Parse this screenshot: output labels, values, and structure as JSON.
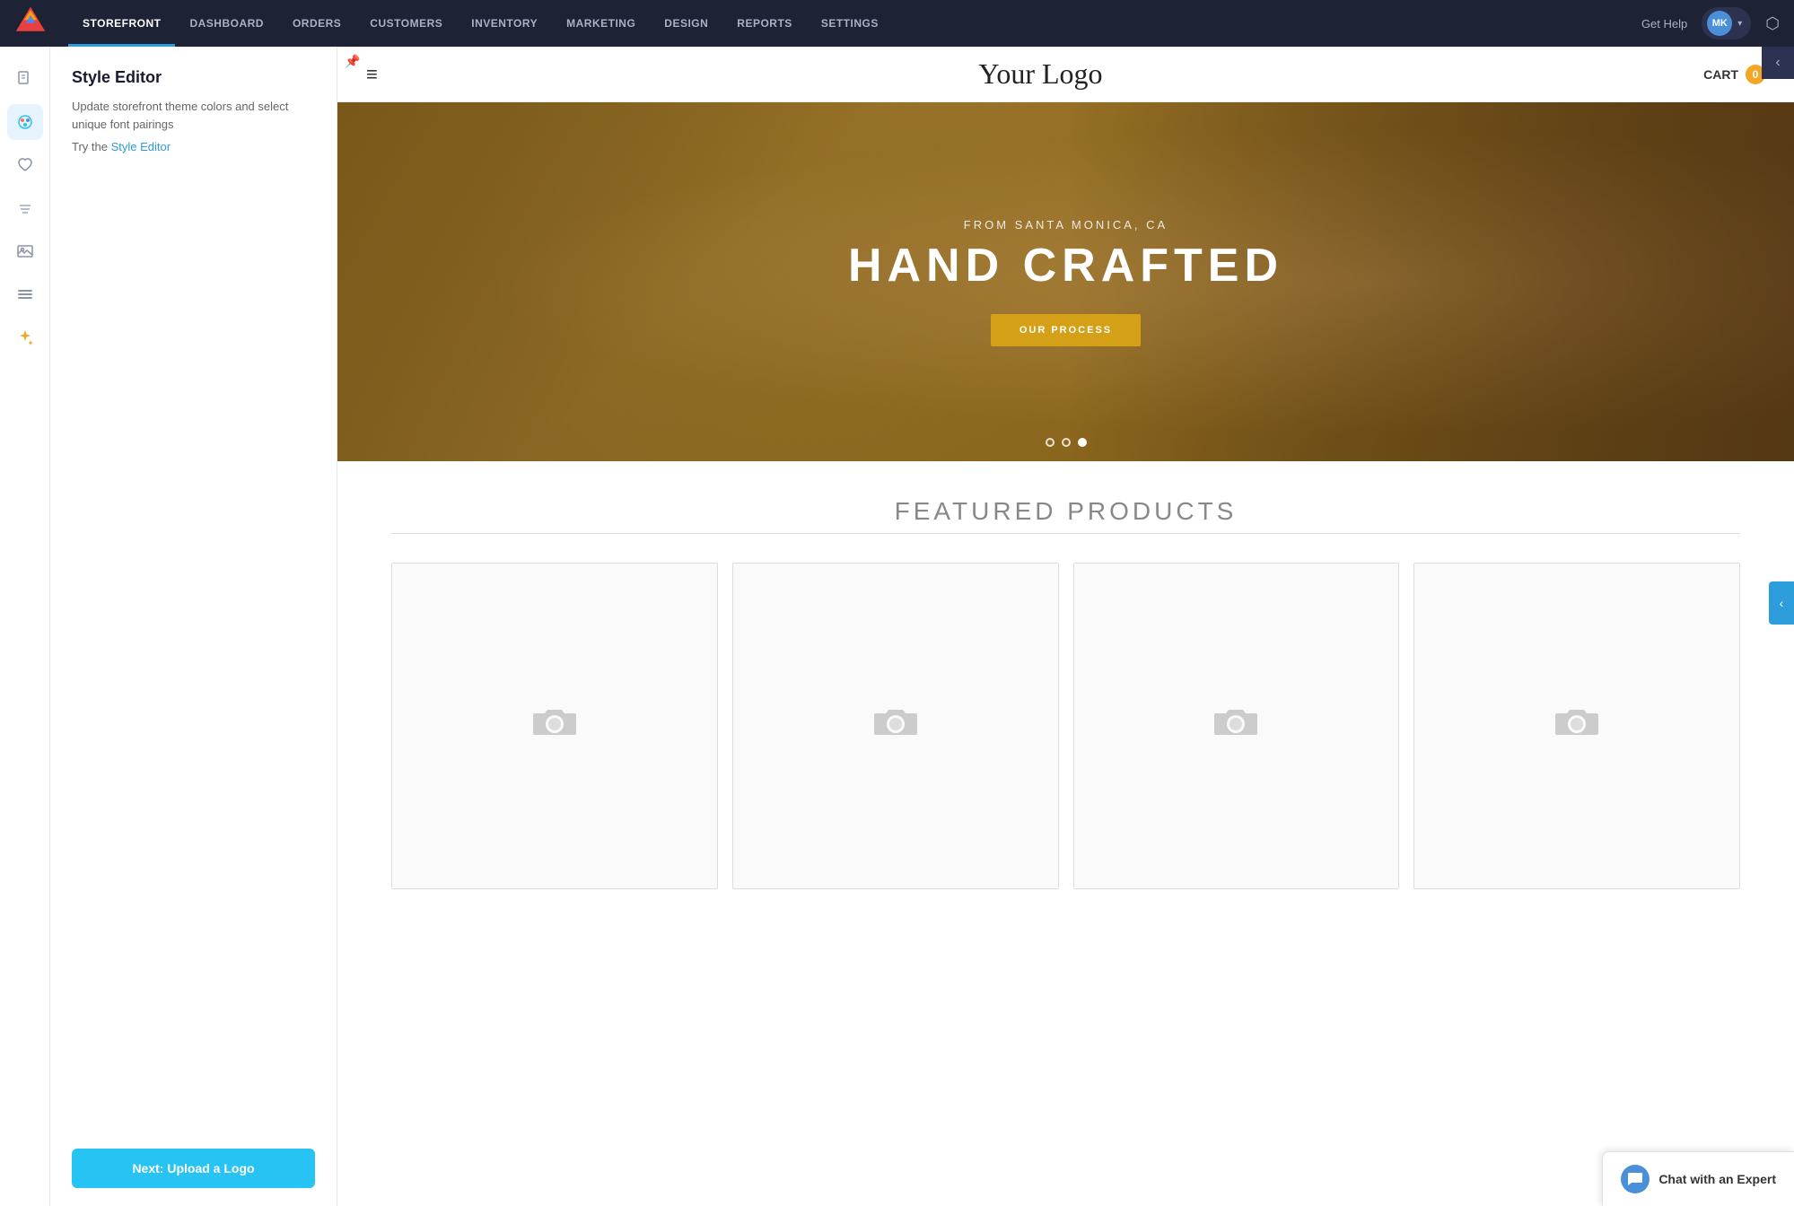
{
  "nav": {
    "items": [
      {
        "id": "storefront",
        "label": "STOREFRONT",
        "active": true
      },
      {
        "id": "dashboard",
        "label": "DASHBOARD",
        "active": false
      },
      {
        "id": "orders",
        "label": "ORDERS",
        "active": false
      },
      {
        "id": "customers",
        "label": "CUSTOMERS",
        "active": false
      },
      {
        "id": "inventory",
        "label": "INVENTORY",
        "active": false
      },
      {
        "id": "marketing",
        "label": "MARKETING",
        "active": false
      },
      {
        "id": "design",
        "label": "DESIGN",
        "active": false
      },
      {
        "id": "reports",
        "label": "REPORTS",
        "active": false
      },
      {
        "id": "settings",
        "label": "SETTINGS",
        "active": false
      }
    ],
    "get_help_label": "Get Help",
    "user_initials": "MK",
    "external_link_symbol": "⬡"
  },
  "style_panel": {
    "title": "Style Editor",
    "description": "Update storefront theme colors and select unique font pairings",
    "try_text": "Try the",
    "link_text": "Style Editor",
    "next_button_label": "Next: Upload a Logo"
  },
  "storefront_preview": {
    "logo": "Your Logo",
    "cart_label": "CART",
    "cart_count": "0",
    "hero": {
      "subtitle": "FROM SANTA MONICA, CA",
      "title": "HAND CRAFTED",
      "button_label": "OUR PROCESS"
    },
    "carousel_dots": [
      {
        "id": 1,
        "active": false
      },
      {
        "id": 2,
        "active": false
      },
      {
        "id": 3,
        "active": true
      }
    ],
    "featured_section": {
      "title": "FEATURED PRODUCTS",
      "products": [
        {
          "id": 1
        },
        {
          "id": 2
        },
        {
          "id": 3
        },
        {
          "id": 4
        }
      ]
    }
  },
  "chat_widget": {
    "label": "Chat with an Expert"
  },
  "icons": {
    "menu": "≡",
    "chevron_left": "‹",
    "chevron_down": "⌄",
    "external": "↗",
    "pin": "📌",
    "camera": "📷",
    "chat": "💬",
    "sidebar_pages": "📄",
    "sidebar_palette": "🎨",
    "sidebar_heart": "♡",
    "sidebar_tshirt": "👕",
    "sidebar_image": "🖼",
    "sidebar_list": "☰",
    "sidebar_magic": "✨"
  },
  "colors": {
    "accent_blue": "#27c3f3",
    "nav_bg": "#1e2235",
    "active_tab_line": "#2d9cdb",
    "collapse_btn": "#2d9cdb",
    "hero_btn": "#d4a017",
    "cart_badge": "#f5a623"
  }
}
